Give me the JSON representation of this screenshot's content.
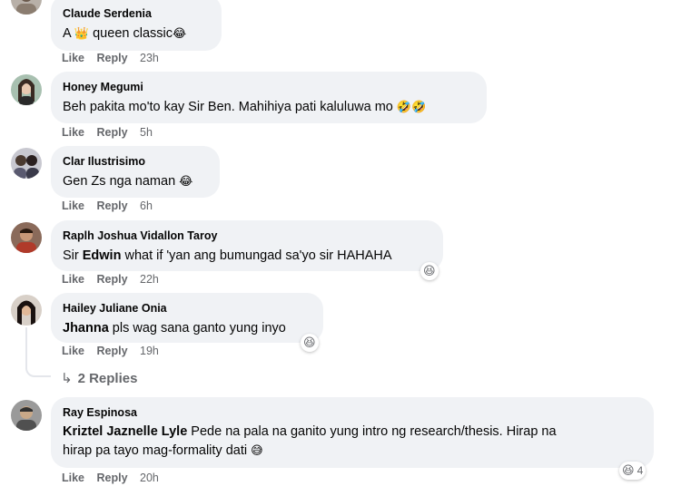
{
  "comments": [
    {
      "author": "Claude Serdenia",
      "text_before": "A ",
      "emoji_mid": "👑",
      "text_after": " queen classic",
      "emoji_end": "😂",
      "like": "Like",
      "reply": "Reply",
      "time": "23h"
    },
    {
      "author": "Honey Megumi",
      "text": "Beh pakita mo'to kay Sir Ben. Mahihiya pati kaluluwa mo ",
      "emoji_end": "🤣🤣",
      "like": "Like",
      "reply": "Reply",
      "time": "5h"
    },
    {
      "author": "Clar Ilustrisimo",
      "text": "Gen Zs nga naman ",
      "emoji_end": "😂",
      "like": "Like",
      "reply": "Reply",
      "time": "6h"
    },
    {
      "author": "Raplh Joshua Vidallon Taroy",
      "text_before": "Sir ",
      "mention": "Edwin",
      "text_after": " what if 'yan ang bumungad sa'yo sir HAHAHA",
      "like": "Like",
      "reply": "Reply",
      "time": "22h",
      "reaction_icon": "😆"
    },
    {
      "author": "Hailey Juliane Onia",
      "mention": "Jhanna",
      "text_after": " pls wag sana ganto yung inyo",
      "like": "Like",
      "reply": "Reply",
      "time": "19h",
      "reaction_icon": "😆",
      "replies_label": "2 Replies",
      "replies_arrow": "↳"
    },
    {
      "author": "Ray Espinosa",
      "mention": "Kriztel Jaznelle Lyle",
      "text_line1": " Pede na pala na ganito yung intro ng research/thesis. Hirap na",
      "text_line2": "hirap pa tayo mag-formality dati ",
      "emoji_end": "😅",
      "like": "Like",
      "reply": "Reply",
      "time": "20h",
      "reaction_icon": "😆",
      "reaction_count": "4"
    }
  ],
  "colors": {
    "bubble": "#f0f2f5",
    "secondary_text": "#65676b",
    "primary_text": "#050505"
  }
}
